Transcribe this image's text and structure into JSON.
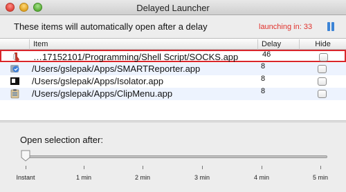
{
  "window": {
    "title": "Delayed Launcher"
  },
  "header": {
    "text": "These items will automatically open after a delay",
    "launching_text": "launching in: 33",
    "launching_color": "#e0302a",
    "pause_icon": "pause-icon"
  },
  "table": {
    "columns": [
      "Item",
      "Delay",
      "Hide"
    ],
    "rows": [
      {
        "icon": "socks-script-icon",
        "path": "…17152101/Programming/Shell Script/SOCKS.app",
        "delay": "46",
        "hide": false
      },
      {
        "icon": "smartreporter-icon",
        "path": "/Users/gslepak/Apps/SMARTReporter.app",
        "delay": "8",
        "hide": false
      },
      {
        "icon": "isolator-icon",
        "path": "/Users/gslepak/Apps/Isolator.app",
        "delay": "8",
        "hide": false
      },
      {
        "icon": "clipmenu-icon",
        "path": "/Users/gslepak/Apps/ClipMenu.app",
        "delay": "8",
        "hide": false
      }
    ]
  },
  "footer": {
    "open_label": "Open selection after:",
    "slider_value": 0,
    "slider_labels": [
      "Instant",
      "1 min",
      "2 min",
      "3 min",
      "4 min",
      "5 min"
    ]
  }
}
